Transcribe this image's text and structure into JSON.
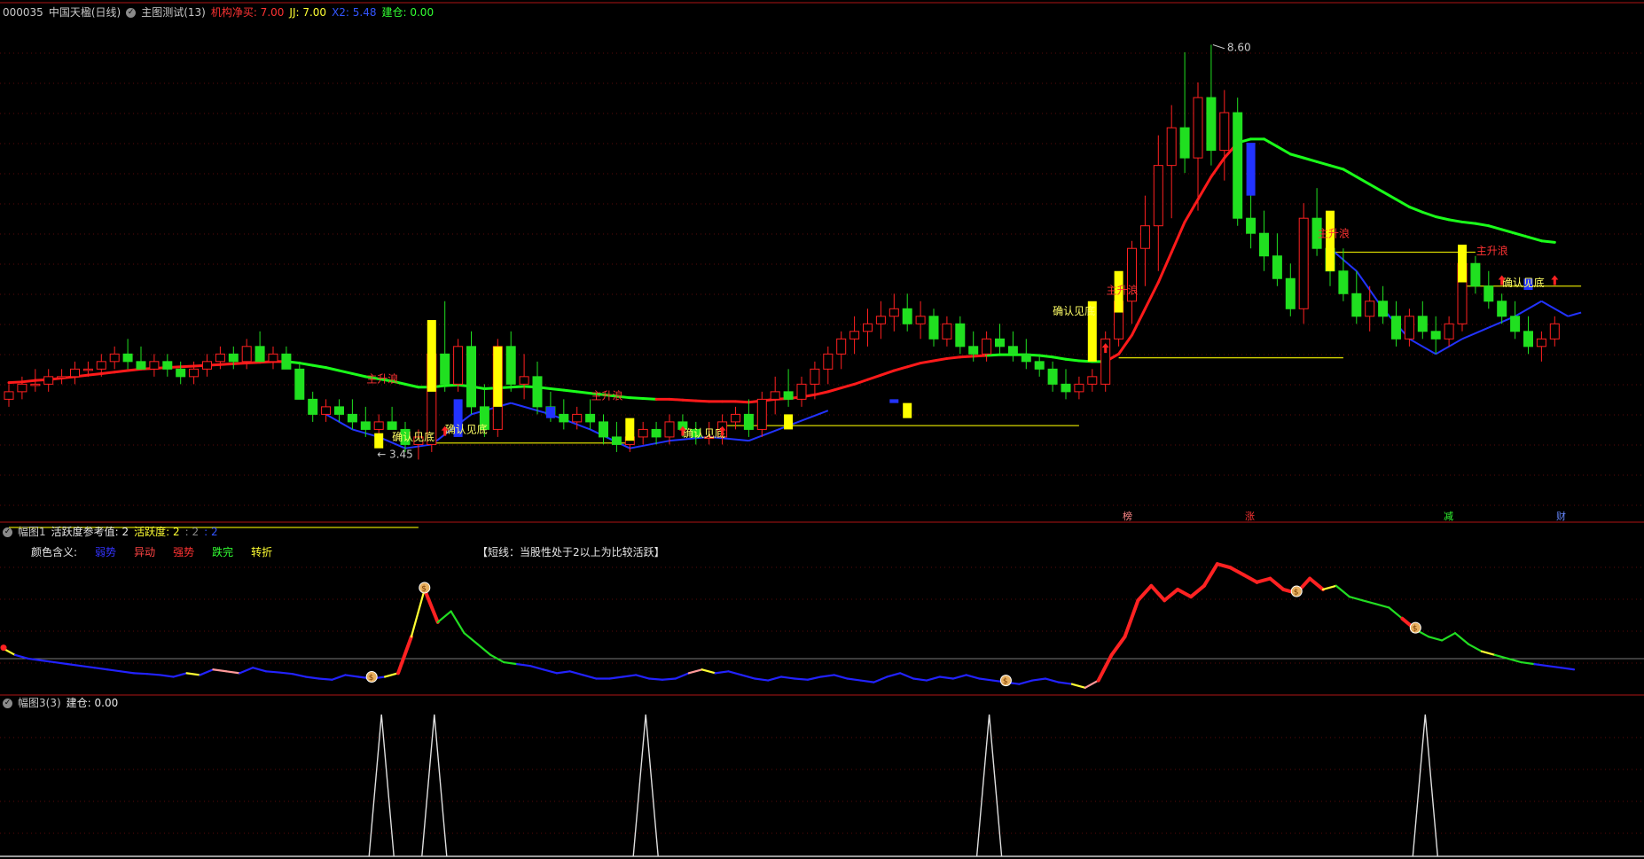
{
  "header": {
    "stock_code": "000035",
    "stock_name": "中国天楹(日线)",
    "indicator_title": "主图测试(13)",
    "items": [
      {
        "label": "机构净买: 7.00",
        "color": "#ff3333"
      },
      {
        "label": "JJ: 7.00",
        "color": "#ffff33"
      },
      {
        "label": "X2: 5.48",
        "color": "#3355ff"
      },
      {
        "label": "建仓: 0.00",
        "color": "#33ff33"
      }
    ]
  },
  "panel2_header": {
    "title": "幅图1",
    "ref_label": "活跃度参考值: 2",
    "active_label": "活跃度: 2",
    "v1": ": 2",
    "v2": ": 2"
  },
  "panel2_legend": {
    "title": "颜色含义:",
    "items": [
      {
        "label": "弱势",
        "color": "#3333ff"
      },
      {
        "label": "异动",
        "color": "#ff4444"
      },
      {
        "label": "强势",
        "color": "#ff3333"
      },
      {
        "label": "跌完",
        "color": "#33ff33"
      },
      {
        "label": "转折",
        "color": "#ffff33"
      }
    ],
    "note": "【短线：当股性处于2以上为比较活跃】"
  },
  "panel3_header": {
    "title": "幅图3(3)",
    "value_label": "建仓: 0.00"
  },
  "chart_labels": {
    "high_price": "8.60",
    "low_price": "3.45",
    "wave_label": "主升浪",
    "confirm_label": "确认见底",
    "bottom_tags": [
      {
        "text": "榜",
        "color": "#ff8888"
      },
      {
        "text": "涨",
        "color": "#ff3333"
      },
      {
        "text": "减",
        "color": "#33ff33"
      },
      {
        "text": "财",
        "color": "#6688ff"
      }
    ]
  },
  "chart_data": {
    "type": "candlestick",
    "price_range": [
      3.0,
      9.3
    ],
    "candles": [
      [
        4.5,
        4.7,
        4.4,
        4.6
      ],
      [
        4.6,
        4.8,
        4.5,
        4.7
      ],
      [
        4.7,
        4.9,
        4.6,
        4.7
      ],
      [
        4.7,
        4.9,
        4.6,
        4.8
      ],
      [
        4.8,
        4.9,
        4.7,
        4.8
      ],
      [
        4.8,
        5.0,
        4.7,
        4.9
      ],
      [
        4.9,
        5.0,
        4.8,
        4.9
      ],
      [
        4.9,
        5.1,
        4.8,
        5.0
      ],
      [
        5.0,
        5.2,
        4.9,
        5.1
      ],
      [
        5.1,
        5.3,
        4.9,
        5.0
      ],
      [
        5.0,
        5.2,
        4.9,
        4.9
      ],
      [
        4.9,
        5.1,
        4.8,
        5.0
      ],
      [
        5.0,
        5.1,
        4.8,
        4.9
      ],
      [
        4.9,
        5.0,
        4.7,
        4.8
      ],
      [
        4.8,
        5.0,
        4.7,
        4.9
      ],
      [
        4.9,
        5.1,
        4.8,
        5.0
      ],
      [
        5.0,
        5.2,
        4.9,
        5.1
      ],
      [
        5.1,
        5.2,
        4.9,
        5.0
      ],
      [
        5.0,
        5.3,
        4.9,
        5.2
      ],
      [
        5.2,
        5.4,
        5.0,
        5.0
      ],
      [
        5.0,
        5.2,
        4.9,
        5.1
      ],
      [
        5.1,
        5.2,
        4.9,
        4.9
      ],
      [
        4.9,
        5.0,
        4.5,
        4.5
      ],
      [
        4.5,
        4.6,
        4.2,
        4.3
      ],
      [
        4.3,
        4.5,
        4.2,
        4.4
      ],
      [
        4.4,
        4.5,
        4.2,
        4.3
      ],
      [
        4.3,
        4.5,
        4.1,
        4.2
      ],
      [
        4.2,
        4.4,
        4.0,
        4.1
      ],
      [
        4.1,
        4.3,
        4.0,
        4.2
      ],
      [
        4.2,
        4.4,
        4.1,
        4.1
      ],
      [
        4.1,
        4.2,
        3.8,
        3.9
      ],
      [
        3.9,
        4.1,
        3.7,
        4.0
      ],
      [
        3.9,
        5.2,
        3.8,
        5.1
      ],
      [
        5.1,
        5.8,
        4.6,
        4.7
      ],
      [
        4.7,
        5.3,
        4.6,
        5.2
      ],
      [
        5.2,
        5.4,
        4.3,
        4.4
      ],
      [
        4.4,
        4.7,
        4.0,
        4.1
      ],
      [
        4.1,
        5.3,
        4.0,
        5.2
      ],
      [
        5.2,
        5.4,
        4.6,
        4.7
      ],
      [
        4.7,
        5.1,
        4.5,
        4.8
      ],
      [
        4.8,
        5.0,
        4.3,
        4.4
      ],
      [
        4.4,
        4.6,
        4.2,
        4.3
      ],
      [
        4.3,
        4.5,
        4.1,
        4.2
      ],
      [
        4.2,
        4.4,
        4.1,
        4.3
      ],
      [
        4.3,
        4.5,
        4.1,
        4.2
      ],
      [
        4.2,
        4.3,
        3.9,
        4.0
      ],
      [
        4.0,
        4.2,
        3.8,
        3.9
      ],
      [
        3.9,
        4.1,
        3.8,
        4.0
      ],
      [
        4.0,
        4.2,
        3.9,
        4.1
      ],
      [
        4.1,
        4.2,
        3.9,
        4.0
      ],
      [
        4.0,
        4.3,
        3.9,
        4.2
      ],
      [
        4.2,
        4.3,
        4.0,
        4.1
      ],
      [
        4.1,
        4.2,
        3.9,
        4.0
      ],
      [
        4.0,
        4.2,
        3.9,
        4.0
      ],
      [
        4.0,
        4.3,
        3.9,
        4.2
      ],
      [
        4.2,
        4.4,
        4.1,
        4.3
      ],
      [
        4.3,
        4.5,
        4.0,
        4.1
      ],
      [
        4.1,
        4.6,
        4.0,
        4.5
      ],
      [
        4.5,
        4.8,
        4.3,
        4.6
      ],
      [
        4.6,
        4.9,
        4.4,
        4.5
      ],
      [
        4.5,
        4.8,
        4.4,
        4.7
      ],
      [
        4.7,
        5.0,
        4.5,
        4.9
      ],
      [
        4.9,
        5.2,
        4.7,
        5.1
      ],
      [
        5.1,
        5.4,
        4.9,
        5.3
      ],
      [
        5.3,
        5.6,
        5.1,
        5.4
      ],
      [
        5.4,
        5.7,
        5.2,
        5.5
      ],
      [
        5.5,
        5.8,
        5.3,
        5.6
      ],
      [
        5.6,
        5.9,
        5.4,
        5.7
      ],
      [
        5.7,
        5.9,
        5.4,
        5.5
      ],
      [
        5.5,
        5.8,
        5.3,
        5.6
      ],
      [
        5.6,
        5.7,
        5.2,
        5.3
      ],
      [
        5.3,
        5.6,
        5.2,
        5.5
      ],
      [
        5.5,
        5.6,
        5.1,
        5.2
      ],
      [
        5.2,
        5.4,
        5.0,
        5.1
      ],
      [
        5.1,
        5.4,
        5.0,
        5.3
      ],
      [
        5.3,
        5.5,
        5.1,
        5.2
      ],
      [
        5.2,
        5.4,
        5.0,
        5.1
      ],
      [
        5.1,
        5.3,
        4.9,
        5.0
      ],
      [
        5.0,
        5.1,
        4.8,
        4.9
      ],
      [
        4.9,
        5.0,
        4.6,
        4.7
      ],
      [
        4.7,
        4.9,
        4.5,
        4.6
      ],
      [
        4.6,
        4.8,
        4.5,
        4.7
      ],
      [
        4.7,
        4.9,
        4.6,
        4.8
      ],
      [
        4.7,
        5.4,
        4.6,
        5.3
      ],
      [
        5.3,
        6.0,
        5.2,
        5.8
      ],
      [
        5.8,
        6.6,
        5.5,
        6.5
      ],
      [
        6.5,
        7.2,
        6.0,
        6.8
      ],
      [
        6.8,
        8.0,
        6.2,
        7.6
      ],
      [
        7.6,
        8.4,
        6.9,
        8.1
      ],
      [
        8.1,
        9.1,
        7.5,
        7.7
      ],
      [
        7.7,
        8.7,
        7.0,
        8.5
      ],
      [
        8.5,
        9.2,
        7.6,
        7.8
      ],
      [
        7.8,
        8.6,
        7.4,
        8.3
      ],
      [
        8.3,
        8.5,
        6.8,
        6.9
      ],
      [
        6.9,
        7.3,
        6.5,
        6.7
      ],
      [
        6.7,
        7.0,
        6.2,
        6.4
      ],
      [
        6.4,
        6.7,
        6.0,
        6.1
      ],
      [
        6.1,
        6.3,
        5.6,
        5.7
      ],
      [
        5.7,
        7.1,
        5.5,
        6.9
      ],
      [
        6.9,
        7.3,
        6.4,
        6.5
      ],
      [
        6.5,
        6.7,
        6.0,
        6.2
      ],
      [
        6.2,
        6.5,
        5.8,
        5.9
      ],
      [
        5.9,
        6.2,
        5.5,
        5.6
      ],
      [
        5.6,
        6.0,
        5.4,
        5.8
      ],
      [
        5.8,
        6.0,
        5.5,
        5.6
      ],
      [
        5.6,
        5.8,
        5.2,
        5.3
      ],
      [
        5.3,
        5.7,
        5.2,
        5.6
      ],
      [
        5.6,
        5.8,
        5.3,
        5.4
      ],
      [
        5.4,
        5.6,
        5.1,
        5.3
      ],
      [
        5.3,
        5.6,
        5.2,
        5.5
      ],
      [
        5.5,
        6.5,
        5.4,
        6.3
      ],
      [
        6.3,
        6.4,
        5.9,
        6.0
      ],
      [
        6.0,
        6.2,
        5.7,
        5.8
      ],
      [
        5.8,
        5.9,
        5.5,
        5.6
      ],
      [
        5.6,
        5.8,
        5.3,
        5.4
      ],
      [
        5.4,
        5.6,
        5.1,
        5.2
      ],
      [
        5.2,
        5.4,
        5.0,
        5.3
      ],
      [
        5.3,
        5.6,
        5.2,
        5.5
      ]
    ],
    "ma_line": [
      4.72,
      4.73,
      4.75,
      4.76,
      4.78,
      4.8,
      4.82,
      4.84,
      4.86,
      4.88,
      4.9,
      4.91,
      4.92,
      4.93,
      4.94,
      4.95,
      4.96,
      4.97,
      4.98,
      4.99,
      5.0,
      5.0,
      4.98,
      4.95,
      4.92,
      4.88,
      4.84,
      4.8,
      4.77,
      4.74,
      4.7,
      4.66,
      4.66,
      4.68,
      4.69,
      4.67,
      4.64,
      4.65,
      4.66,
      4.67,
      4.66,
      4.64,
      4.62,
      4.6,
      4.58,
      4.56,
      4.54,
      4.52,
      4.51,
      4.5,
      4.5,
      4.49,
      4.48,
      4.47,
      4.47,
      4.47,
      4.46,
      4.48,
      4.5,
      4.51,
      4.53,
      4.56,
      4.6,
      4.65,
      4.7,
      4.76,
      4.82,
      4.88,
      4.93,
      4.98,
      5.01,
      5.04,
      5.06,
      5.07,
      5.08,
      5.09,
      5.09,
      5.09,
      5.08,
      5.06,
      5.03,
      5.01,
      5.0,
      5.0,
      5.1,
      5.35,
      5.7,
      6.05,
      6.45,
      6.85,
      7.15,
      7.45,
      7.7,
      7.9,
      7.95,
      7.95,
      7.85,
      7.75,
      7.7,
      7.65,
      7.6,
      7.55,
      7.45,
      7.35,
      7.25,
      7.15,
      7.05,
      6.98,
      6.92,
      6.88,
      6.85,
      6.83,
      6.8,
      6.75,
      6.7,
      6.65,
      6.6,
      6.58
    ],
    "ma_colors": [
      "#ff1a1a",
      "#ff1a1a",
      "#ff1a1a",
      "#ff1a1a",
      "#ff1a1a",
      "#ff1a1a",
      "#ff1a1a",
      "#ff1a1a",
      "#ff1a1a",
      "#ff1a1a",
      "#ff1a1a",
      "#ff1a1a",
      "#ff1a1a",
      "#ff1a1a",
      "#ff1a1a",
      "#ff1a1a",
      "#ff1a1a",
      "#ff1a1a",
      "#ff1a1a",
      "#ff1a1a",
      "#ff1a1a",
      "#ff1a1a",
      "#1aff1a",
      "#1aff1a",
      "#1aff1a",
      "#1aff1a",
      "#1aff1a",
      "#1aff1a",
      "#1aff1a",
      "#1aff1a",
      "#1aff1a",
      "#1aff1a",
      "#1aff1a",
      "#1aff1a",
      "#1aff1a",
      "#1aff1a",
      "#1aff1a",
      "#1aff1a",
      "#1aff1a",
      "#1aff1a",
      "#1aff1a",
      "#1aff1a",
      "#1aff1a",
      "#1aff1a",
      "#1aff1a",
      "#1aff1a",
      "#1aff1a",
      "#1aff1a",
      "#1aff1a",
      "#1aff1a",
      "#ff1a1a",
      "#ff1a1a",
      "#ff1a1a",
      "#ff1a1a",
      "#ff1a1a",
      "#ff1a1a",
      "#ff1a1a",
      "#ff1a1a",
      "#ff1a1a",
      "#ff1a1a",
      "#ff1a1a",
      "#ff1a1a",
      "#ff1a1a",
      "#ff1a1a",
      "#ff1a1a",
      "#ff1a1a",
      "#ff1a1a",
      "#ff1a1a",
      "#ff1a1a",
      "#ff1a1a",
      "#ff1a1a",
      "#ff1a1a",
      "#ff1a1a",
      "#ff1a1a",
      "#ff1a1a",
      "#1aff1a",
      "#1aff1a",
      "#1aff1a",
      "#1aff1a",
      "#1aff1a",
      "#1aff1a",
      "#1aff1a",
      "#1aff1a",
      "#1aff1a",
      "#ff1a1a",
      "#ff1a1a",
      "#ff1a1a",
      "#ff1a1a",
      "#ff1a1a",
      "#ff1a1a",
      "#ff1a1a",
      "#ff1a1a",
      "#ff1a1a",
      "#ff1a1a",
      "#1aff1a",
      "#1aff1a",
      "#1aff1a",
      "#1aff1a",
      "#1aff1a",
      "#1aff1a",
      "#1aff1a",
      "#1aff1a",
      "#1aff1a",
      "#1aff1a",
      "#1aff1a",
      "#1aff1a",
      "#1aff1a",
      "#1aff1a",
      "#1aff1a",
      "#1aff1a",
      "#1aff1a",
      "#1aff1a",
      "#1aff1a",
      "#1aff1a",
      "#1aff1a",
      "#1aff1a",
      "#1aff1a",
      "#1aff1a",
      "#1aff1a",
      "#1aff1a"
    ],
    "blue_support": [
      [
        24,
        4.3
      ],
      [
        26,
        4.1
      ],
      [
        28,
        4.0
      ],
      [
        30,
        3.85
      ],
      [
        32,
        3.9
      ],
      [
        35,
        4.3
      ],
      [
        38,
        4.45
      ],
      [
        41,
        4.3
      ],
      [
        44,
        4.1
      ],
      [
        47,
        3.85
      ],
      [
        50,
        3.95
      ],
      [
        53,
        4.0
      ],
      [
        56,
        3.95
      ],
      [
        59,
        4.15
      ],
      [
        62,
        4.35
      ],
      [
        100,
        6.5
      ],
      [
        102,
        6.2
      ],
      [
        104,
        5.7
      ],
      [
        106,
        5.3
      ],
      [
        108,
        5.1
      ],
      [
        110,
        5.3
      ],
      [
        112,
        5.45
      ],
      [
        114,
        5.6
      ],
      [
        116,
        5.8
      ],
      [
        118,
        5.6
      ],
      [
        119,
        5.65
      ]
    ],
    "yellow_levels": [
      {
        "from": 0,
        "to": 31,
        "price": 2.8
      },
      {
        "from": 32,
        "to": 47,
        "price": 3.92
      },
      {
        "from": 54,
        "to": 81,
        "price": 4.15
      },
      {
        "from": 84,
        "to": 101,
        "price": 5.05
      },
      {
        "from": 100,
        "to": 111,
        "price": 6.45
      },
      {
        "from": 110,
        "to": 119,
        "price": 6.0
      }
    ],
    "yellow_bars": [
      [
        28,
        3.85,
        4.05
      ],
      [
        32,
        4.6,
        5.55
      ],
      [
        37,
        4.4,
        5.2
      ],
      [
        47,
        3.95,
        4.25
      ],
      [
        59,
        4.1,
        4.3
      ],
      [
        68,
        4.25,
        4.45
      ],
      [
        82,
        5.0,
        5.8
      ],
      [
        84,
        5.65,
        6.2
      ],
      [
        100,
        6.2,
        7.0
      ],
      [
        110,
        6.05,
        6.55
      ]
    ],
    "blue_bars": [
      [
        34,
        4.0,
        4.5
      ],
      [
        41,
        4.25,
        4.4
      ],
      [
        67,
        4.45,
        4.5
      ],
      [
        94,
        7.2,
        7.9
      ],
      [
        115,
        5.95,
        6.1
      ]
    ],
    "activity_y": [
      3.9,
      3.7,
      3.6,
      3.55,
      3.5,
      3.45,
      3.4,
      3.35,
      3.3,
      3.25,
      3.2,
      3.18,
      3.15,
      3.1,
      3.2,
      3.15,
      3.3,
      3.25,
      3.2,
      3.35,
      3.25,
      3.22,
      3.18,
      3.1,
      3.05,
      3.02,
      3.15,
      3.1,
      3.05,
      3.1,
      3.2,
      4.2,
      5.5,
      4.6,
      4.9,
      4.3,
      4.0,
      3.7,
      3.5,
      3.45,
      3.4,
      3.3,
      3.2,
      3.25,
      3.15,
      3.05,
      3.05,
      3.1,
      3.15,
      3.05,
      3.02,
      3.05,
      3.2,
      3.3,
      3.2,
      3.25,
      3.15,
      3.05,
      3.0,
      3.1,
      3.05,
      3.02,
      3.1,
      3.15,
      3.05,
      3.0,
      2.95,
      3.1,
      3.2,
      3.05,
      3.0,
      3.1,
      3.05,
      3.15,
      3.05,
      3.0,
      2.95,
      2.9,
      3.0,
      3.05,
      2.95,
      2.9,
      2.8,
      3.0,
      3.7,
      4.2,
      5.2,
      5.6,
      5.2,
      5.5,
      5.3,
      5.6,
      6.2,
      6.1,
      5.9,
      5.7,
      5.8,
      5.5,
      5.4,
      5.8,
      5.5,
      5.6,
      5.3,
      5.2,
      5.1,
      5.0,
      4.7,
      4.4,
      4.2,
      4.1,
      4.3,
      4.0,
      3.8,
      3.7,
      3.6,
      3.5,
      3.45,
      3.4,
      3.35,
      3.3
    ],
    "activity_colors": [
      "#ff2222",
      "#ffff33",
      "#2222ff",
      "#2222ff",
      "#2222ff",
      "#2222ff",
      "#2222ff",
      "#2222ff",
      "#2222ff",
      "#2222ff",
      "#2222ff",
      "#2222ff",
      "#2222ff",
      "#2222ff",
      "#2222ff",
      "#ffff33",
      "#2222ff",
      "#ff9999",
      "#ff9999",
      "#2222ff",
      "#2222ff",
      "#2222ff",
      "#2222ff",
      "#2222ff",
      "#2222ff",
      "#2222ff",
      "#2222ff",
      "#2222ff",
      "#2222ff",
      "#2222ff",
      "#ffff33",
      "#ff2222",
      "#ffff33",
      "#ff2222",
      "#22dd22",
      "#22dd22",
      "#22dd22",
      "#22dd22",
      "#22dd22",
      "#22dd22",
      "#2222ff",
      "#2222ff",
      "#2222ff",
      "#2222ff",
      "#2222ff",
      "#2222ff",
      "#2222ff",
      "#2222ff",
      "#2222ff",
      "#2222ff",
      "#2222ff",
      "#2222ff",
      "#2222ff",
      "#ff9999",
      "#ffff33",
      "#2222ff",
      "#2222ff",
      "#2222ff",
      "#2222ff",
      "#2222ff",
      "#2222ff",
      "#2222ff",
      "#2222ff",
      "#2222ff",
      "#2222ff",
      "#2222ff",
      "#2222ff",
      "#2222ff",
      "#2222ff",
      "#2222ff",
      "#2222ff",
      "#2222ff",
      "#2222ff",
      "#2222ff",
      "#2222ff",
      "#2222ff",
      "#2222ff",
      "#2222ff",
      "#2222ff",
      "#2222ff",
      "#2222ff",
      "#2222ff",
      "#ffff33",
      "#ff9999",
      "#ff2222",
      "#ff2222",
      "#ff2222",
      "#ff2222",
      "#ff2222",
      "#ff2222",
      "#ff2222",
      "#ff2222",
      "#ff2222",
      "#ff2222",
      "#ff2222",
      "#ff2222",
      "#ff2222",
      "#ff2222",
      "#ff2222",
      "#ff2222",
      "#ff2222",
      "#ffff33",
      "#22dd22",
      "#22dd22",
      "#22dd22",
      "#22dd22",
      "#22dd22",
      "#ff2222",
      "#22dd22",
      "#22dd22",
      "#22dd22",
      "#22dd22",
      "#22dd22",
      "#ffff33",
      "#22dd22",
      "#22dd22",
      "#22dd22",
      "#2222ff",
      "#2222ff",
      "#2222ff",
      "#2222ff"
    ],
    "activity_markers": [
      28,
      32,
      76,
      98,
      107
    ],
    "spikes": [
      28,
      32,
      48,
      74,
      107
    ]
  },
  "colors": {
    "up": "#ff2020",
    "down": "#20e020",
    "separator": "#8b1010",
    "grid": "#5a0a0a"
  }
}
